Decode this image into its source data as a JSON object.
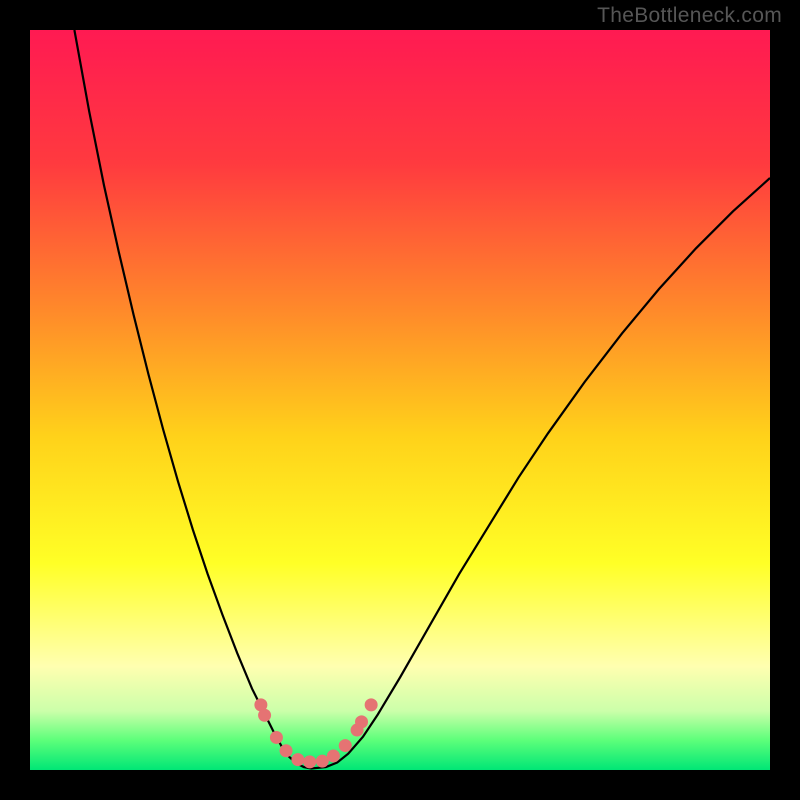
{
  "attribution": "TheBottleneck.com",
  "chart_data": {
    "type": "line",
    "title": "",
    "xlabel": "",
    "ylabel": "",
    "xlim": [
      0,
      100
    ],
    "ylim": [
      0,
      100
    ],
    "background_gradient_stops": [
      {
        "pos": 0.0,
        "color": "#ff1a52"
      },
      {
        "pos": 0.18,
        "color": "#ff3a3f"
      },
      {
        "pos": 0.38,
        "color": "#ff8a2a"
      },
      {
        "pos": 0.55,
        "color": "#ffd21a"
      },
      {
        "pos": 0.72,
        "color": "#ffff26"
      },
      {
        "pos": 0.86,
        "color": "#ffffb0"
      },
      {
        "pos": 0.92,
        "color": "#ccffaa"
      },
      {
        "pos": 0.96,
        "color": "#5cff7a"
      },
      {
        "pos": 1.0,
        "color": "#00e676"
      }
    ],
    "series": [
      {
        "name": "bottleneck-curve",
        "color": "#000000",
        "width": 2.2,
        "points": [
          {
            "x": 6.0,
            "y": 100.0
          },
          {
            "x": 8.0,
            "y": 89.0
          },
          {
            "x": 10.0,
            "y": 79.0
          },
          {
            "x": 12.0,
            "y": 70.0
          },
          {
            "x": 14.0,
            "y": 61.5
          },
          {
            "x": 16.0,
            "y": 53.5
          },
          {
            "x": 18.0,
            "y": 46.0
          },
          {
            "x": 20.0,
            "y": 39.0
          },
          {
            "x": 22.0,
            "y": 32.5
          },
          {
            "x": 24.0,
            "y": 26.5
          },
          {
            "x": 26.0,
            "y": 21.0
          },
          {
            "x": 28.0,
            "y": 15.8
          },
          {
            "x": 30.0,
            "y": 11.0
          },
          {
            "x": 31.5,
            "y": 8.0
          },
          {
            "x": 33.0,
            "y": 5.0
          },
          {
            "x": 34.0,
            "y": 3.2
          },
          {
            "x": 35.0,
            "y": 1.8
          },
          {
            "x": 36.0,
            "y": 0.9
          },
          {
            "x": 37.0,
            "y": 0.4
          },
          {
            "x": 38.0,
            "y": 0.2
          },
          {
            "x": 40.0,
            "y": 0.4
          },
          {
            "x": 41.5,
            "y": 1.0
          },
          {
            "x": 43.0,
            "y": 2.2
          },
          {
            "x": 45.0,
            "y": 4.5
          },
          {
            "x": 47.0,
            "y": 7.5
          },
          {
            "x": 50.0,
            "y": 12.5
          },
          {
            "x": 54.0,
            "y": 19.5
          },
          {
            "x": 58.0,
            "y": 26.5
          },
          {
            "x": 62.0,
            "y": 33.0
          },
          {
            "x": 66.0,
            "y": 39.5
          },
          {
            "x": 70.0,
            "y": 45.5
          },
          {
            "x": 75.0,
            "y": 52.5
          },
          {
            "x": 80.0,
            "y": 59.0
          },
          {
            "x": 85.0,
            "y": 65.0
          },
          {
            "x": 90.0,
            "y": 70.5
          },
          {
            "x": 95.0,
            "y": 75.5
          },
          {
            "x": 100.0,
            "y": 80.0
          }
        ]
      }
    ],
    "markers": {
      "color": "#e57373",
      "radius": 6.5,
      "points": [
        {
          "x": 31.2,
          "y": 8.8
        },
        {
          "x": 31.7,
          "y": 7.4
        },
        {
          "x": 33.3,
          "y": 4.4
        },
        {
          "x": 34.6,
          "y": 2.6
        },
        {
          "x": 36.2,
          "y": 1.4
        },
        {
          "x": 37.8,
          "y": 1.1
        },
        {
          "x": 39.5,
          "y": 1.2
        },
        {
          "x": 41.0,
          "y": 1.9
        },
        {
          "x": 42.6,
          "y": 3.3
        },
        {
          "x": 44.2,
          "y": 5.4
        },
        {
          "x": 44.8,
          "y": 6.5
        },
        {
          "x": 46.1,
          "y": 8.8
        }
      ]
    }
  }
}
